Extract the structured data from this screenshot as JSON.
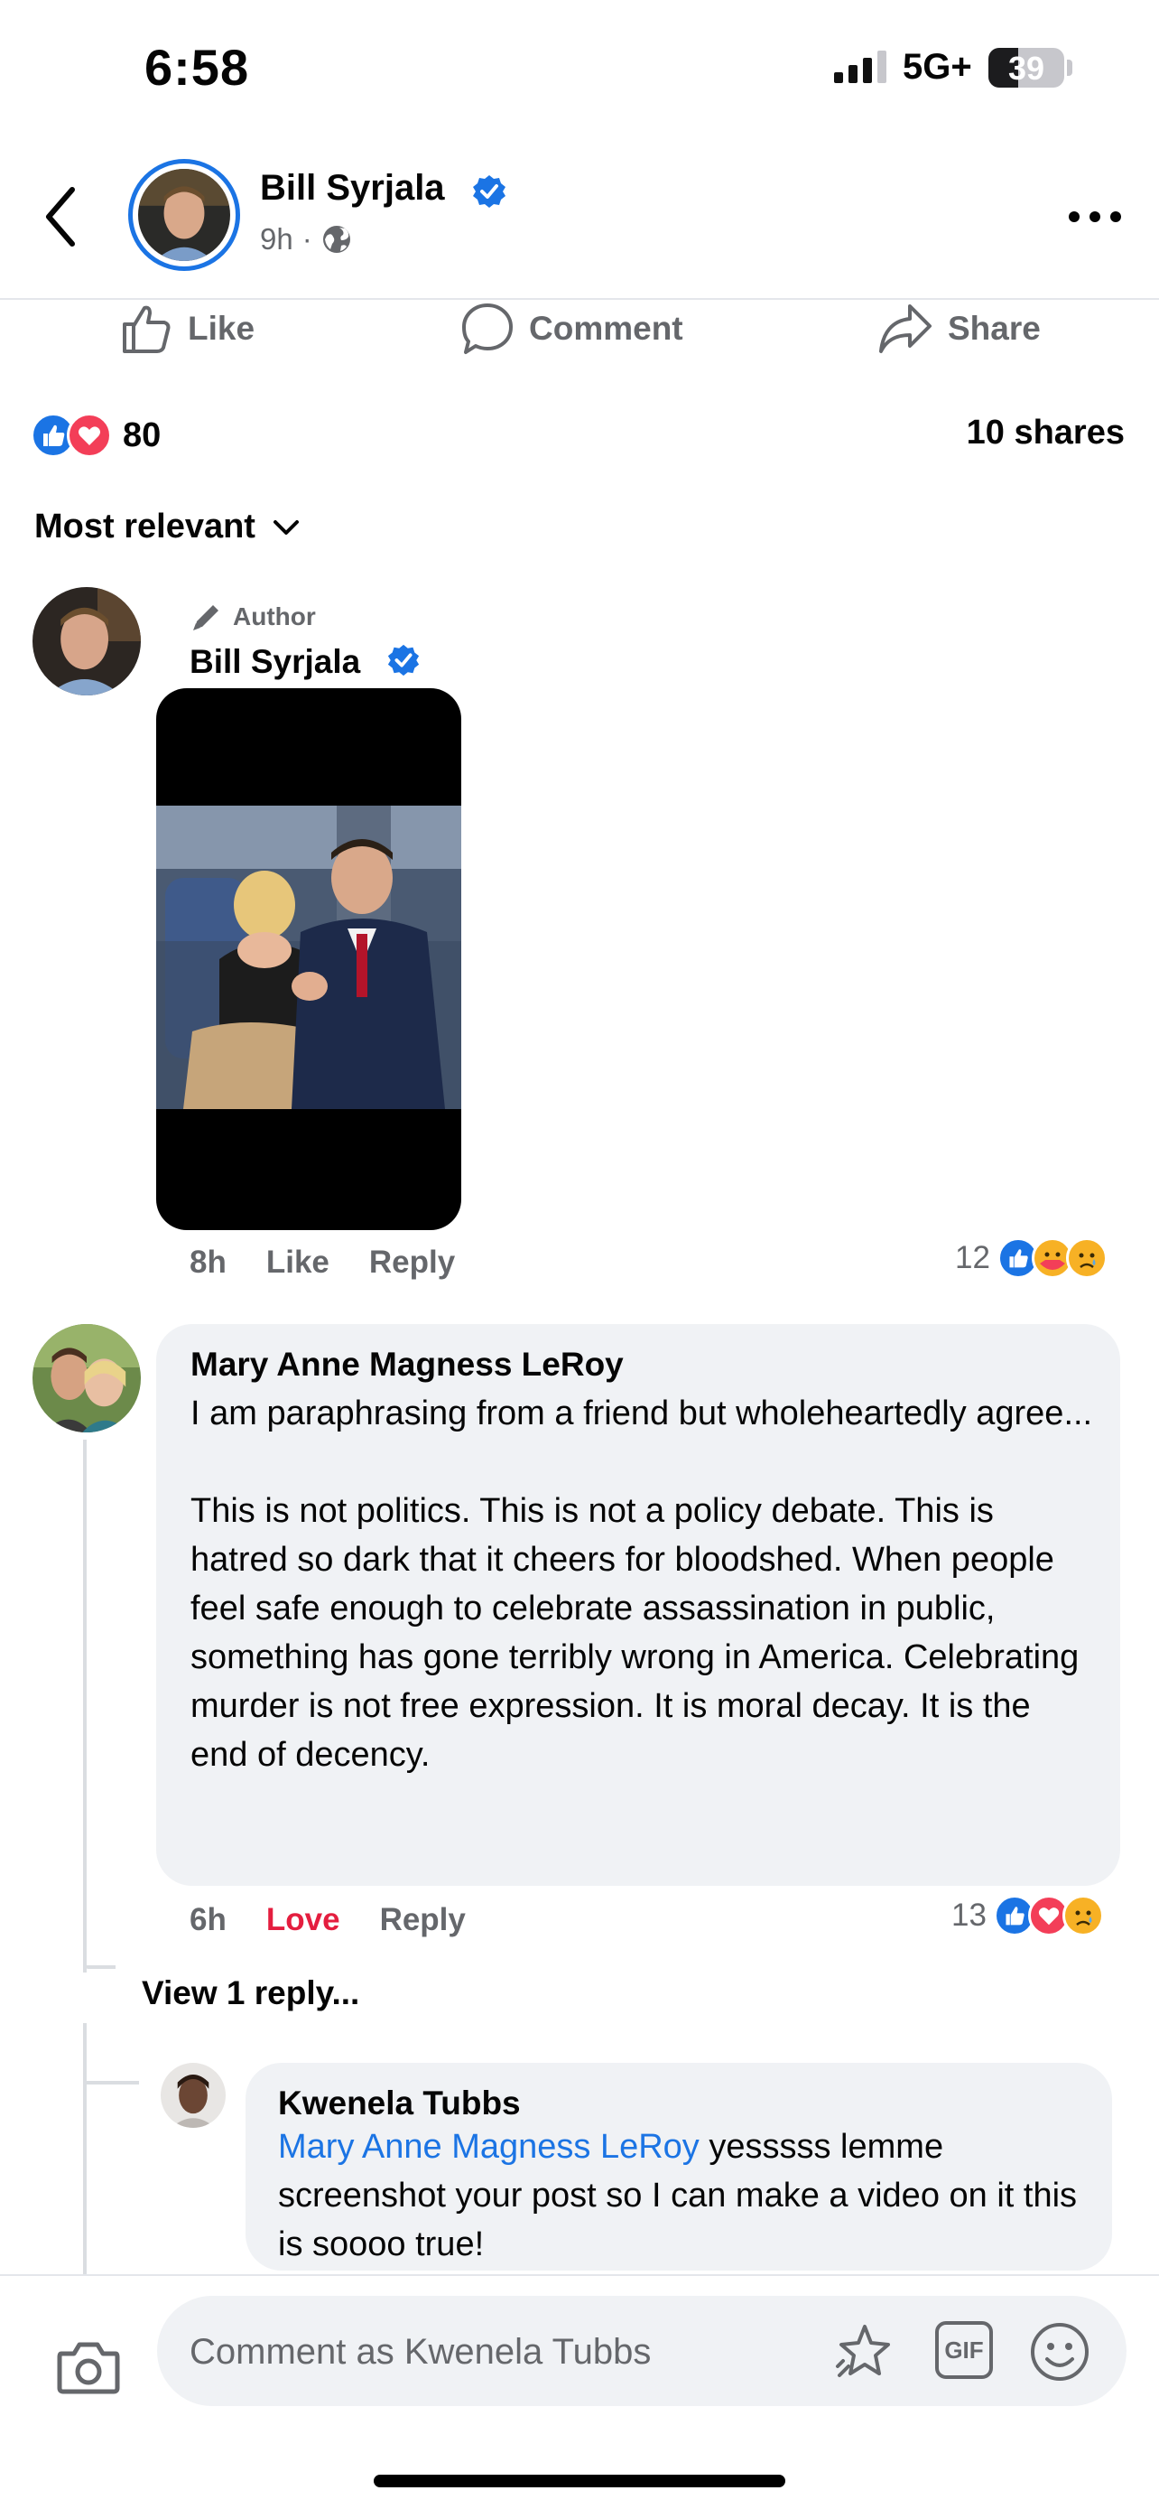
{
  "status_bar": {
    "time": "6:58",
    "network": "5G+",
    "battery": "39",
    "battery_level": 0.39
  },
  "header": {
    "author_name": "Bill Syrjala",
    "time_ago": "9h",
    "audience_icon": "globe-icon"
  },
  "actions": {
    "like": "Like",
    "comment": "Comment",
    "share": "Share"
  },
  "reactions": {
    "count": "80",
    "types": [
      "like",
      "love"
    ],
    "shares": "10 shares"
  },
  "sort": {
    "label": "Most relevant"
  },
  "comments": [
    {
      "author_tag": "Author",
      "name": "Bill Syrjala",
      "verified": true,
      "has_photo": true,
      "time": "8h",
      "like_label": "Like",
      "reply_label": "Reply",
      "reaction_count": "12",
      "reaction_types": [
        "like",
        "care",
        "sad"
      ]
    },
    {
      "name": "Mary Anne Magness LeRoy",
      "text": "I am paraphrasing from a friend but wholeheartedly agree...\n\nThis is not politics. This is not a policy debate. This is hatred so dark that it cheers for bloodshed. When people feel safe enough to celebrate assassination in public, something has gone terribly wrong in America. Celebrating murder is not free expression. It is moral decay. It is the end of decency.",
      "time": "6h",
      "like_label": "Love",
      "reply_label": "Reply",
      "reaction_count": "13",
      "reaction_types": [
        "like",
        "love",
        "sad"
      ],
      "view_replies": "View 1 reply..."
    },
    {
      "name": "Kwenela Tubbs",
      "mention": "Mary Anne Magness LeRoy",
      "text": " yesssss lemme screenshot your post so I can make a video on it this is soooo true!"
    }
  ],
  "composer": {
    "placeholder": "Comment as Kwenela Tubbs",
    "gif_label": "GIF"
  },
  "colors": {
    "accent": "#1b74e4",
    "love": "#e41e3f",
    "muted": "#65676b",
    "bubble": "#f0f2f5"
  }
}
